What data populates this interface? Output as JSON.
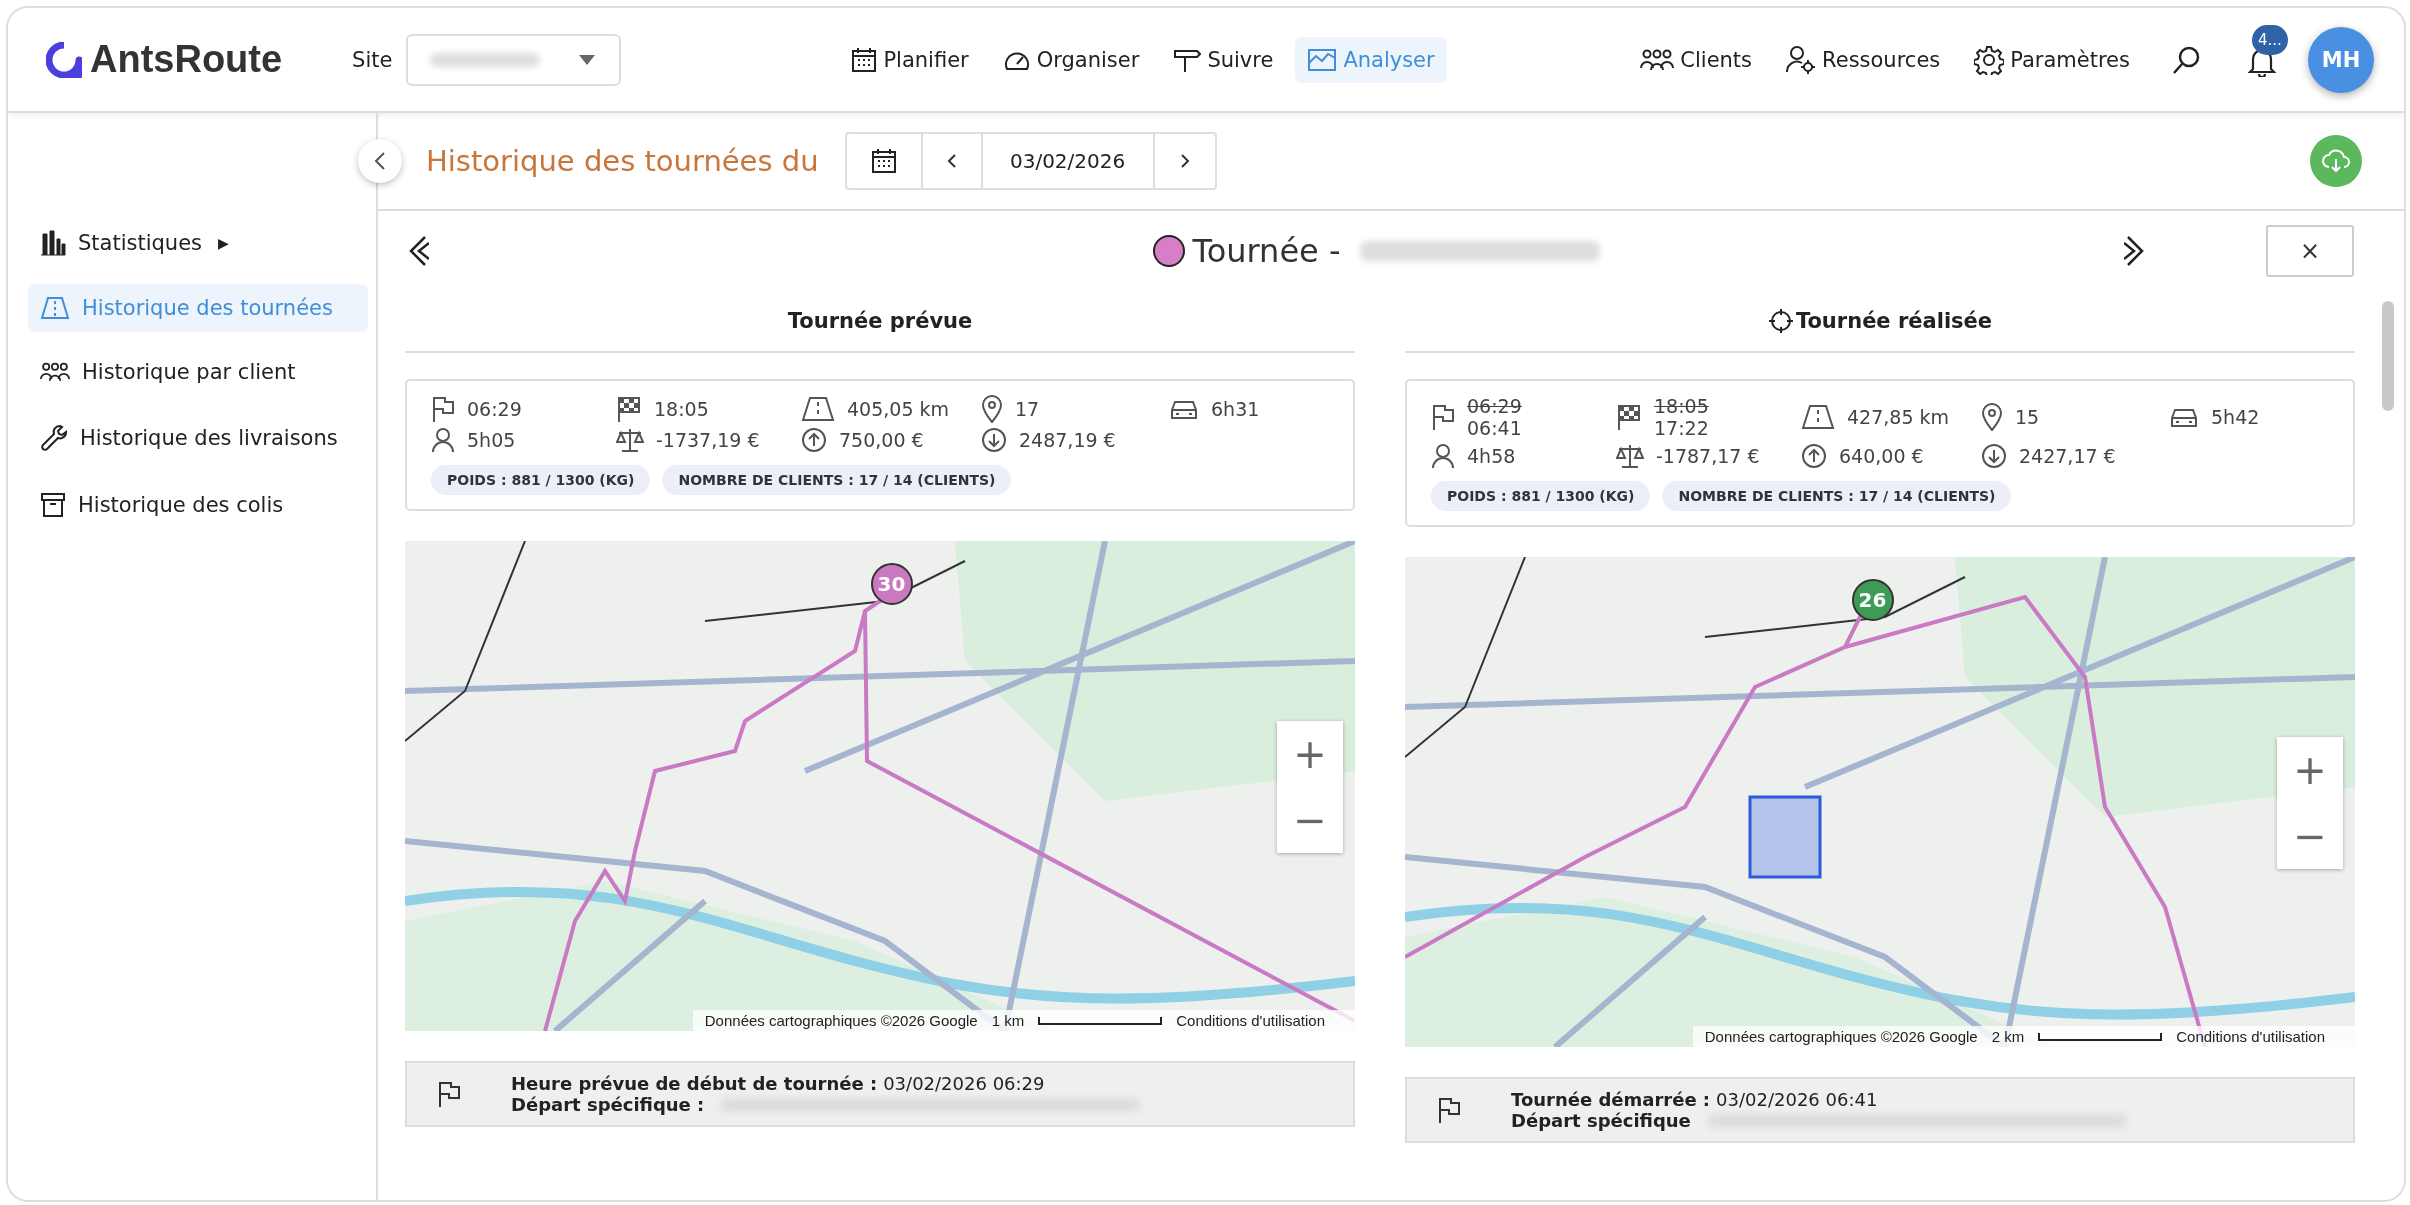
{
  "header": {
    "logo": "AntsRoute",
    "site_label": "Site",
    "nav": [
      {
        "label": "Planifier",
        "selected": false
      },
      {
        "label": "Organiser",
        "selected": false
      },
      {
        "label": "Suivre",
        "selected": false
      },
      {
        "label": "Analyser",
        "selected": true
      }
    ],
    "right_nav": [
      {
        "label": "Clients"
      },
      {
        "label": "Ressources"
      },
      {
        "label": "Paramètres"
      }
    ],
    "notification_badge": "4...",
    "avatar": "MH"
  },
  "sidebar": {
    "items": [
      {
        "label": "Statistiques",
        "arrow": "▶",
        "selected": false
      },
      {
        "label": "Historique des tournées",
        "selected": true
      },
      {
        "label": "Historique par client",
        "selected": false
      },
      {
        "label": "Historique des livraisons",
        "selected": false
      },
      {
        "label": "Historique des colis",
        "selected": false
      }
    ]
  },
  "toolbar": {
    "title": "Historique des tournées du",
    "date": "03/02/2026"
  },
  "tour": {
    "title": "Tournée -",
    "color": "#d77fc6",
    "close": "×"
  },
  "columns": [
    {
      "heading": "Tournée prévue",
      "kind": "planned",
      "stats": [
        {
          "value": "06:29"
        },
        {
          "value": "18:05"
        },
        {
          "value": "405,05 km"
        },
        {
          "value": "17"
        },
        {
          "value": "6h31"
        },
        {
          "value": "5h05"
        },
        {
          "value": "-1737,19 €"
        },
        {
          "value": "750,00 €"
        },
        {
          "value": "2487,19 €"
        }
      ],
      "tags": [
        "POIDS : 881 / 1300 (KG)",
        "NOMBRE DE CLIENTS : 17 / 14 (CLIENTS)"
      ],
      "map": {
        "marker": "30",
        "color": "#c979c0",
        "attribution": "Données cartographiques ©2026 Google",
        "scale": "1 km",
        "terms": "Conditions d'utilisation",
        "zoom_in": "+",
        "zoom_out": "−"
      },
      "info": [
        {
          "label": "Heure prévue de début de tournée :",
          "value": "03/02/2026 06:29"
        },
        {
          "label": "Départ spécifique :"
        }
      ]
    },
    {
      "heading": "Tournée réalisée",
      "kind": "actual",
      "stats": [
        {
          "value": "06:41",
          "previous": "06:29"
        },
        {
          "value": "17:22",
          "previous": "18:05"
        },
        {
          "value": "427,85 km"
        },
        {
          "value": "15"
        },
        {
          "value": "5h42"
        },
        {
          "value": "4h58"
        },
        {
          "value": "-1787,17 €"
        },
        {
          "value": "640,00 €"
        },
        {
          "value": "2427,17 €"
        }
      ],
      "tags": [
        "POIDS : 881 / 1300 (KG)",
        "NOMBRE DE CLIENTS : 17 / 14 (CLIENTS)"
      ],
      "map": {
        "marker": "26",
        "color": "#3f9a55",
        "attribution": "Données cartographiques ©2026 Google",
        "scale": "2 km",
        "terms": "Conditions d'utilisation",
        "zoom_in": "+",
        "zoom_out": "−"
      },
      "info": [
        {
          "label": "Tournée démarrée :",
          "value": "03/02/2026 06:41"
        },
        {
          "label": "Départ spécifique"
        }
      ]
    }
  ]
}
